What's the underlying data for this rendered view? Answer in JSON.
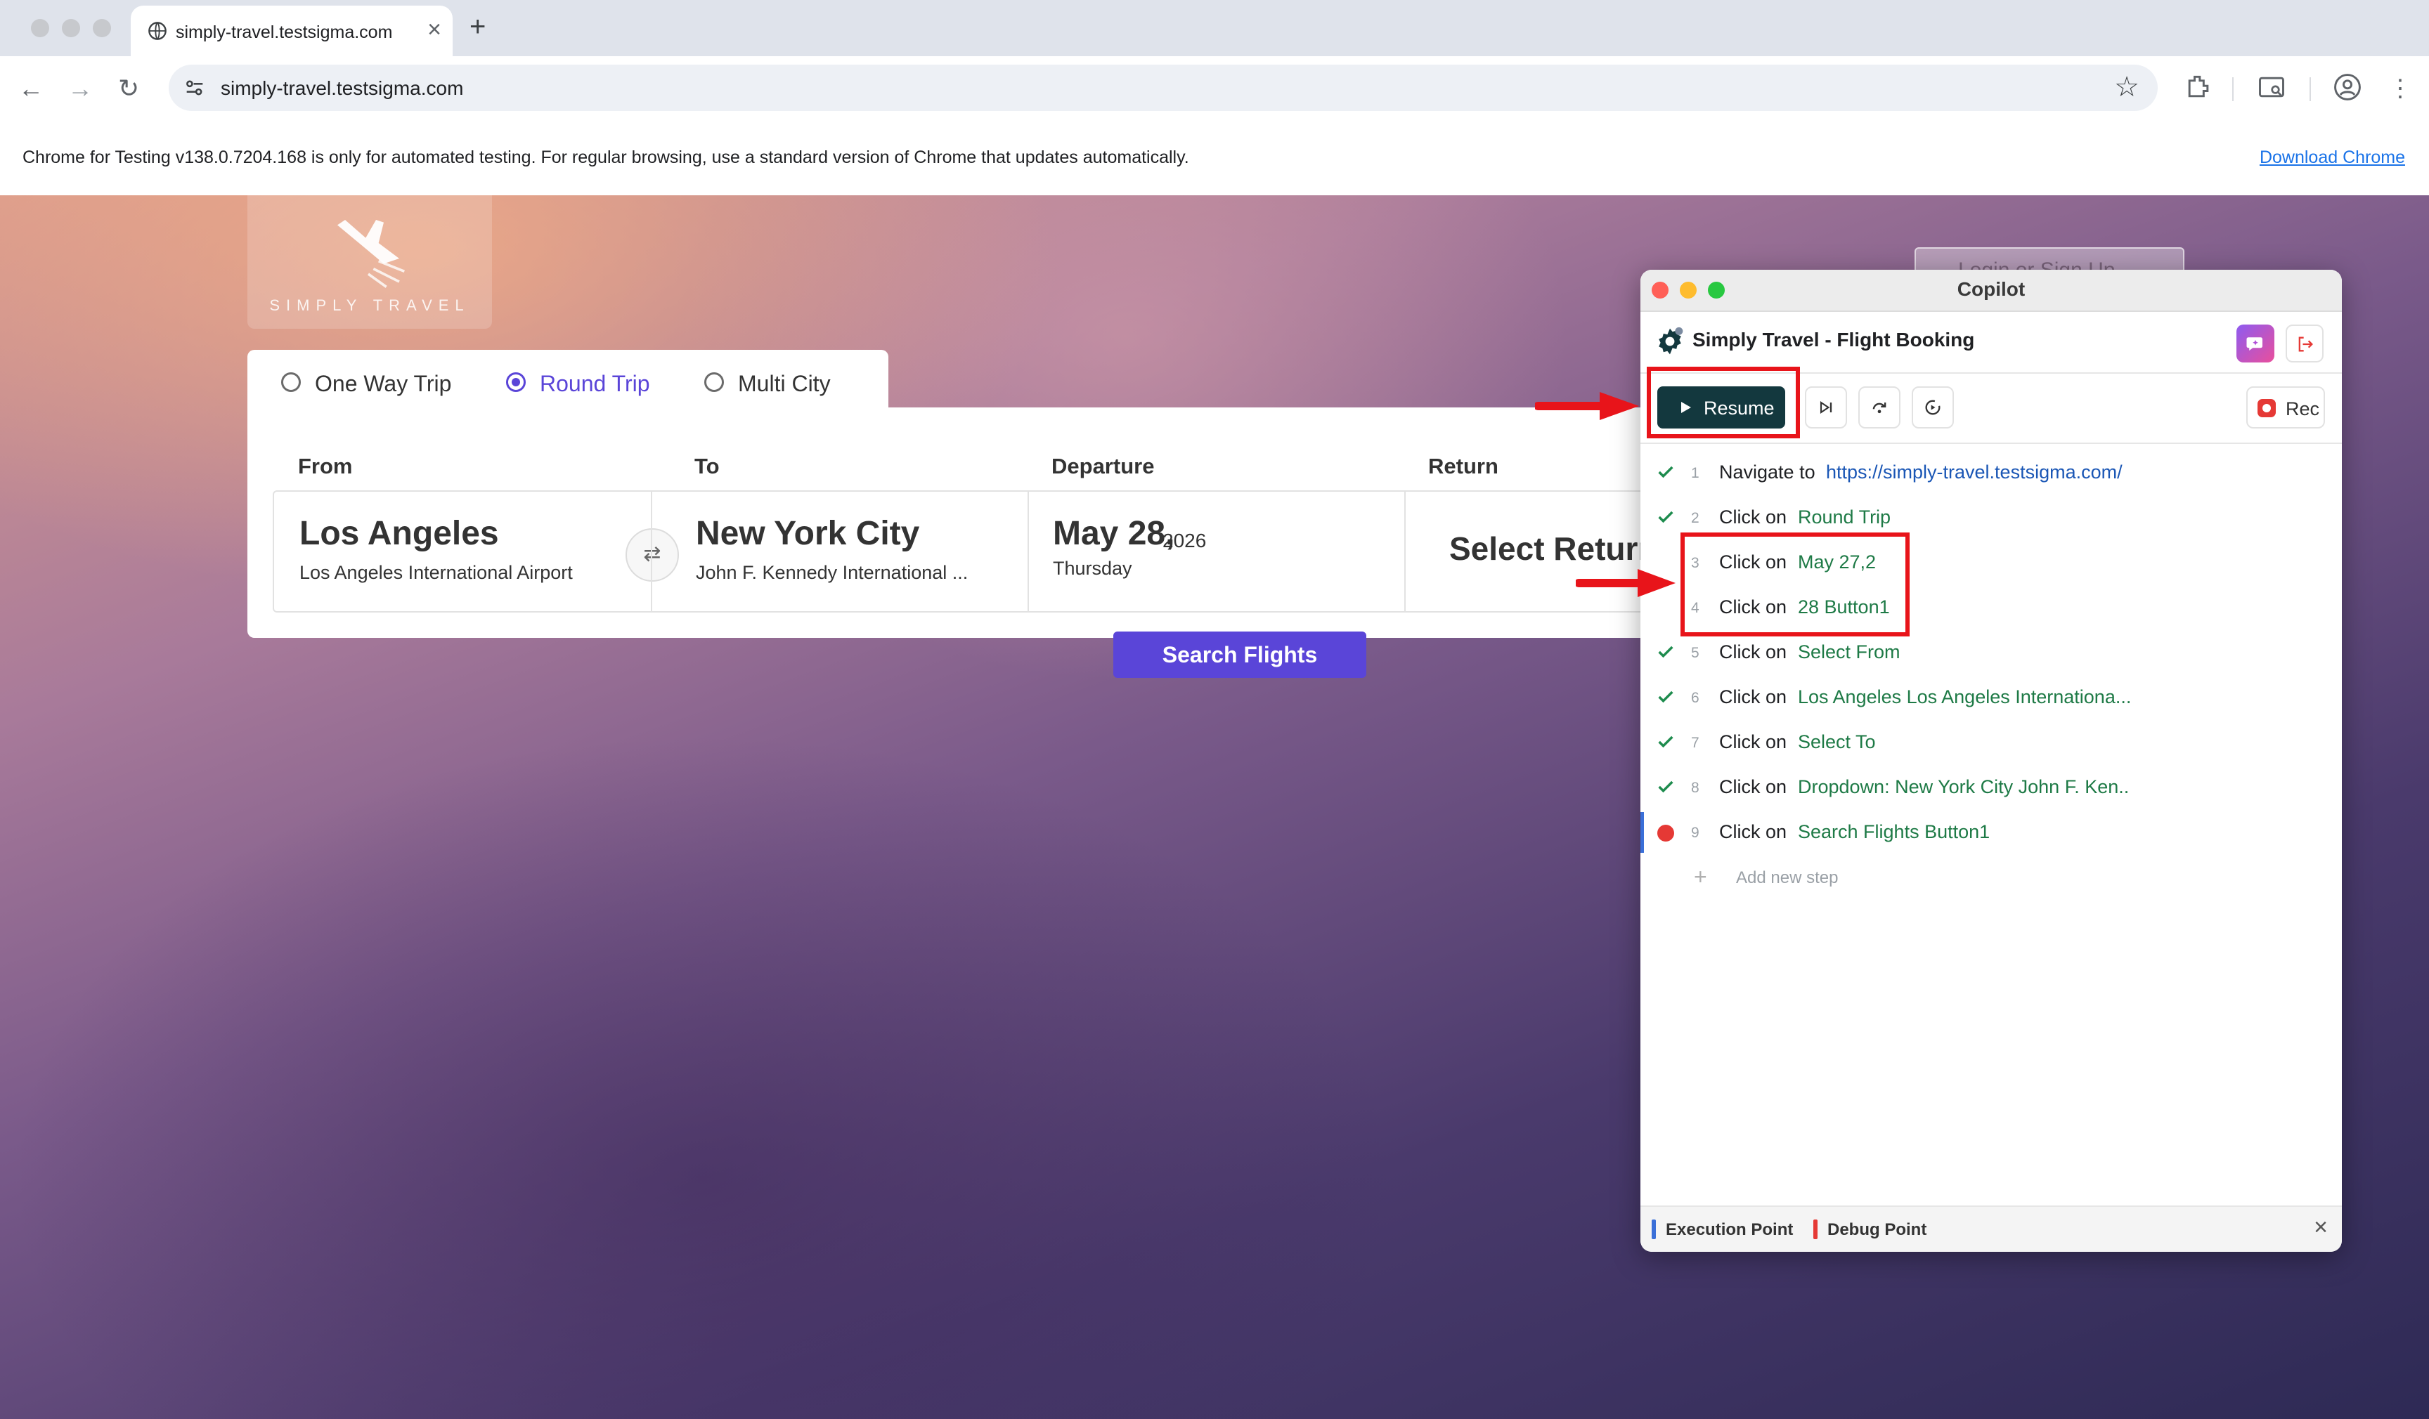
{
  "browser": {
    "tab_title": "simply-travel.testsigma.com",
    "new_tab": "+",
    "close_tab": "×",
    "url": "simply-travel.testsigma.com",
    "infobar_message": "Chrome for Testing v138.0.7204.168 is only for automated testing. For regular browsing, use a standard version of Chrome that updates automatically.",
    "infobar_link": "Download Chrome"
  },
  "site": {
    "logo_text": "SIMPLY TRAVEL",
    "login_label": "Login or Sign Up",
    "trip_types": [
      {
        "label": "One Way Trip",
        "selected": false
      },
      {
        "label": "Round Trip",
        "selected": true
      },
      {
        "label": "Multi City",
        "selected": false
      }
    ],
    "headers": {
      "from": "From",
      "to": "To",
      "departure": "Departure",
      "return": "Return"
    },
    "from": {
      "city": "Los Angeles",
      "airport": "Los Angeles International Airport"
    },
    "to": {
      "city": "New York City",
      "airport": "John F. Kennedy International ..."
    },
    "departure": {
      "date": "May 28,",
      "year": "2026",
      "weekday": "Thursday"
    },
    "return": {
      "placeholder": "Select Return"
    },
    "search_label": "Search Flights",
    "accent_color": "#5a45d8"
  },
  "copilot": {
    "window_title": "Copilot",
    "project_title": "Simply Travel - Flight Booking",
    "resume_label": "Resume",
    "rec_label": "Rec",
    "steps": [
      {
        "num": "1",
        "status": "passed",
        "action": "Navigate to",
        "target": "https://simply-travel.testsigma.com/"
      },
      {
        "num": "2",
        "status": "passed",
        "action": "Click on",
        "target": "Round Trip"
      },
      {
        "num": "3",
        "status": "pending",
        "action": "Click on",
        "target": "May 27,2"
      },
      {
        "num": "4",
        "status": "pending",
        "action": "Click on",
        "target": "28 Button1"
      },
      {
        "num": "5",
        "status": "passed",
        "action": "Click on",
        "target": "Select From"
      },
      {
        "num": "6",
        "status": "passed",
        "action": "Click on",
        "target": "Los Angeles Los Angeles Internationa..."
      },
      {
        "num": "7",
        "status": "passed",
        "action": "Click on",
        "target": "Select To"
      },
      {
        "num": "8",
        "status": "passed",
        "action": "Click on",
        "target": "Dropdown: New York City John F. Ken.."
      },
      {
        "num": "9",
        "status": "debug",
        "action": "Click on",
        "target": "Search Flights Button1"
      }
    ],
    "add_step_label": "Add new step",
    "legend": {
      "execution": "Execution Point",
      "debug": "Debug Point"
    },
    "colors": {
      "execution": "#3a6fd8",
      "debug": "#e53935",
      "passed": "#1e8c4e"
    }
  }
}
